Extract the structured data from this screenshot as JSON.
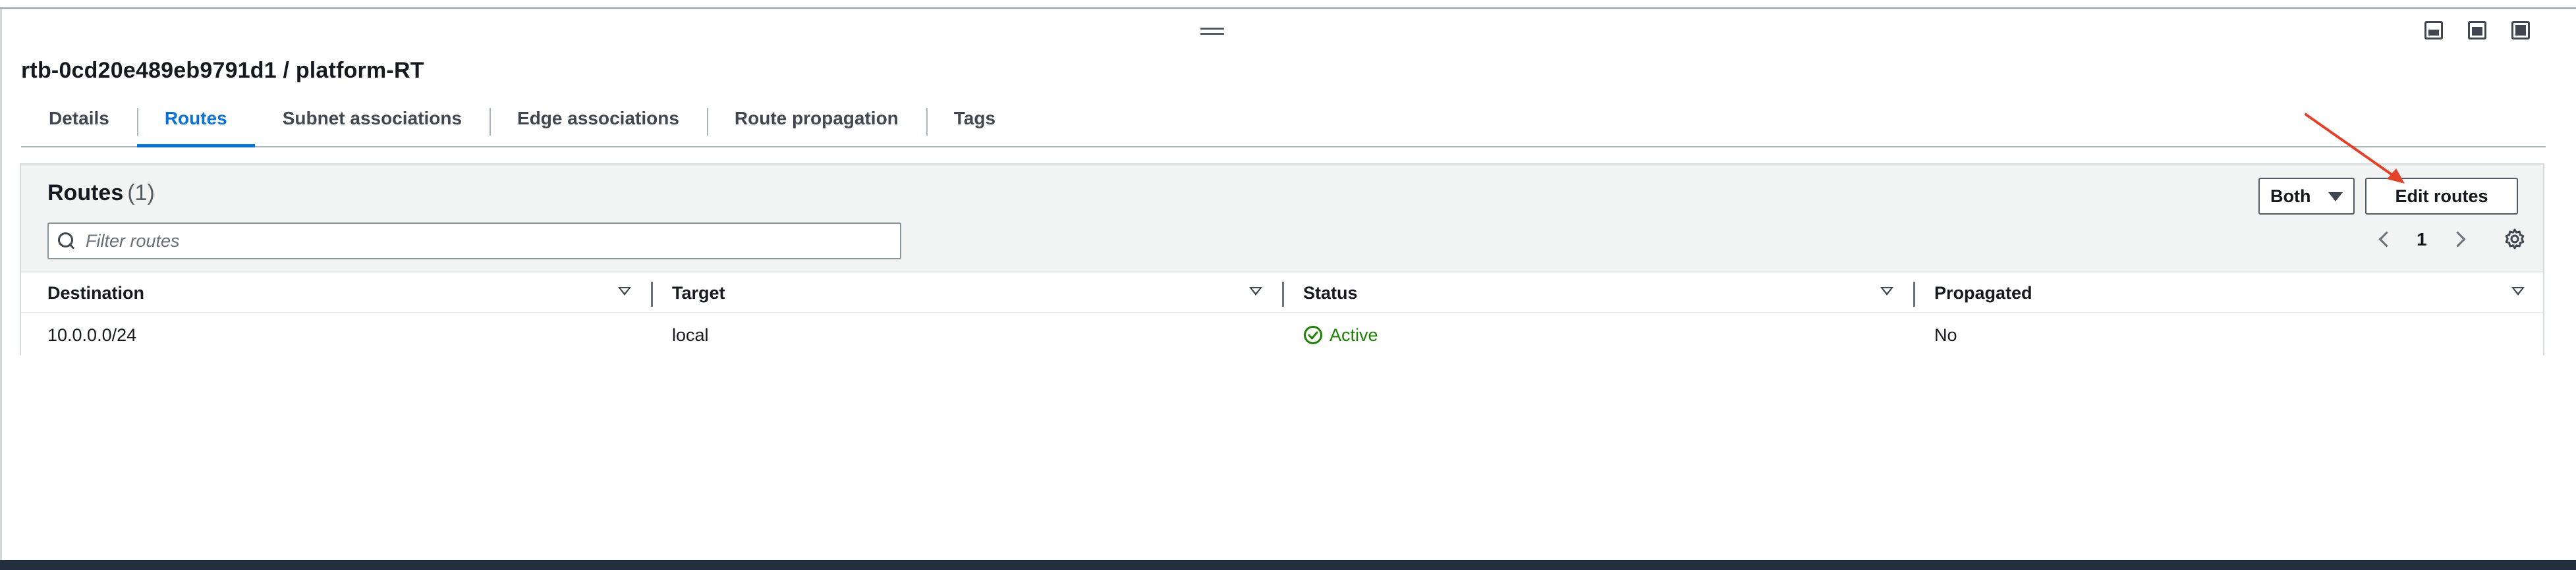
{
  "page": {
    "title": "rtb-0cd20e489eb9791d1 / platform-RT"
  },
  "window_controls": [
    {
      "icon": "layout-bottom-icon"
    },
    {
      "icon": "layout-side-icon"
    },
    {
      "icon": "layout-full-icon"
    }
  ],
  "tabs": [
    {
      "label": "Details",
      "active": false
    },
    {
      "label": "Routes",
      "active": true
    },
    {
      "label": "Subnet associations",
      "active": false
    },
    {
      "label": "Edge associations",
      "active": false
    },
    {
      "label": "Route propagation",
      "active": false
    },
    {
      "label": "Tags",
      "active": false
    }
  ],
  "routes_panel": {
    "title": "Routes",
    "count": "(1)",
    "filter_placeholder": "Filter routes",
    "filter_value": "",
    "ip_select_value": "Both",
    "edit_button_label": "Edit routes",
    "current_page": "1",
    "columns": [
      "Destination",
      "Target",
      "Status",
      "Propagated"
    ],
    "rows": [
      {
        "destination": "10.0.0.0/24",
        "target": "local",
        "status": "Active",
        "propagated": "No"
      }
    ]
  },
  "colors": {
    "accent": "#0972d3",
    "status_active": "#1d8102",
    "annotation_arrow": "#e4412b"
  }
}
